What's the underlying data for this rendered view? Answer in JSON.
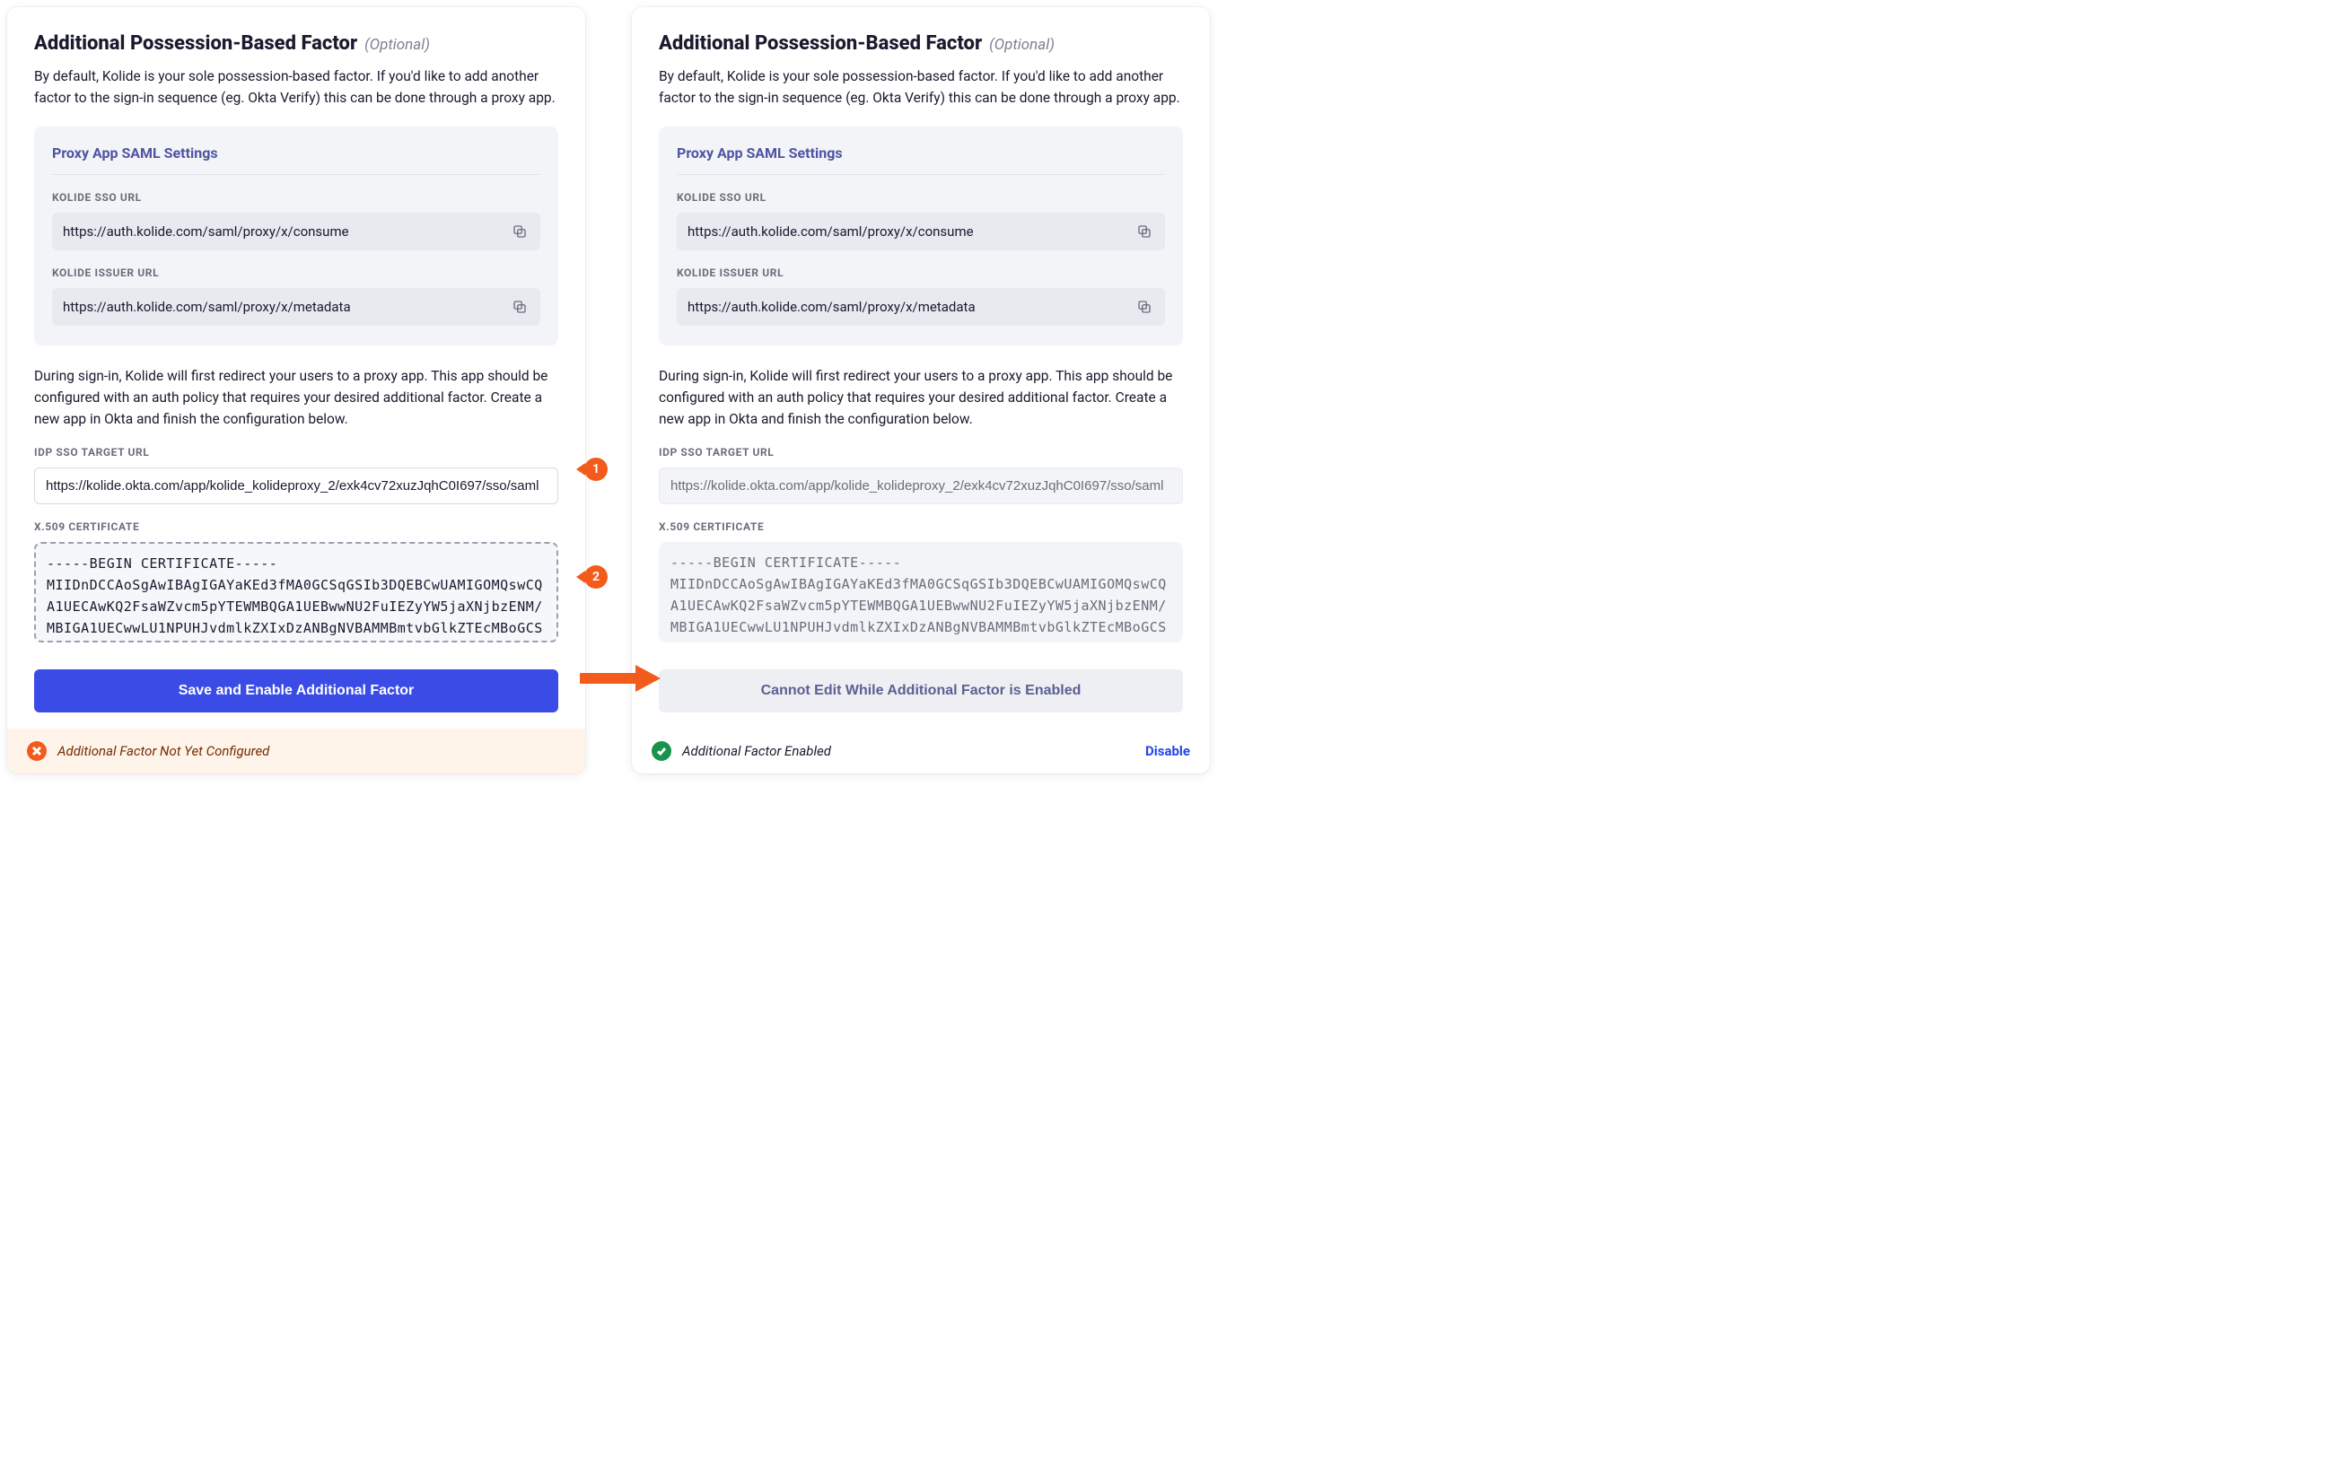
{
  "title": "Additional Possession-Based Factor",
  "title_optional": "(Optional)",
  "description": "By default, Kolide is your sole possession-based factor. If you'd like to add another factor to the sign-in sequence (eg. Okta Verify) this can be done through a proxy app.",
  "panel": {
    "title": "Proxy App SAML Settings",
    "sso_label": "KOLIDE SSO URL",
    "sso_value": "https://auth.kolide.com/saml/proxy/x/consume",
    "issuer_label": "KOLIDE ISSUER URL",
    "issuer_value": "https://auth.kolide.com/saml/proxy/x/metadata"
  },
  "section_desc": "During sign-in, Kolide will first redirect your users to a proxy app. This app should be configured with an auth policy that requires your desired additional factor. Create a new app in Okta and finish the configuration below.",
  "idp_label": "IDP SSO TARGET URL",
  "idp_value": "https://kolide.okta.com/app/kolide_kolideproxy_2/exk4cv72xuzJqhC0I697/sso/saml",
  "cert_label": "X.509 CERTIFICATE",
  "cert_value": "-----BEGIN CERTIFICATE-----\nMIIDnDCCAoSgAwIBAgIGAYaKEd3fMA0GCSqGSIb3DQEBCwUAMIGOMQswCQ\nA1UECAwKQ2FsaWZvcm5pYTEWMBQGA1UEBwwNU2FuIEZyYW5jaXNjbzENM/\nMBIGA1UECwwLU1NPUHJvdmlkZXIxDzANBgNVBAMMBmtvbGlkZTEcMBoGCS",
  "primary_button": "Save and Enable Additional Factor",
  "disabled_button": "Cannot Edit While Additional Factor is Enabled",
  "footer_warn": "Additional Factor Not Yet Configured",
  "footer_ok": "Additional Factor Enabled",
  "disable_link": "Disable",
  "badge1": "1",
  "badge2": "2"
}
